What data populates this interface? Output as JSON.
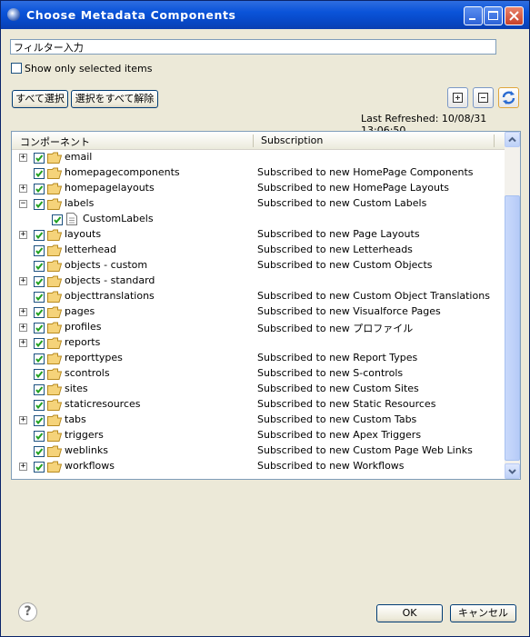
{
  "window": {
    "title": "Choose Metadata Components"
  },
  "filter": {
    "value": "フィルター入力"
  },
  "show_selected": {
    "label": "Show only selected items",
    "checked": false
  },
  "buttons": {
    "select_all": "すべて選択",
    "deselect_all": "選択をすべて解除",
    "ok": "OK",
    "cancel": "キャンセル"
  },
  "toolbar": {
    "expand_all_icon": "expand-all-icon",
    "collapse_all_icon": "collapse-all-icon",
    "refresh_icon": "refresh-icon"
  },
  "last_refreshed": "Last Refreshed: 10/08/31 13:06:50",
  "table": {
    "headers": [
      "コンポーネント",
      "Subscription"
    ],
    "rows": [
      {
        "name": "email",
        "subscription": "",
        "expander": "+",
        "level": 0,
        "type": "folder",
        "checked": true
      },
      {
        "name": "homepagecomponents",
        "subscription": "Subscribed to new HomePage Components",
        "expander": "",
        "level": 0,
        "type": "folder",
        "checked": true
      },
      {
        "name": "homepagelayouts",
        "subscription": "Subscribed to new HomePage Layouts",
        "expander": "+",
        "level": 0,
        "type": "folder",
        "checked": true
      },
      {
        "name": "labels",
        "subscription": "Subscribed to new Custom Labels",
        "expander": "−",
        "level": 0,
        "type": "folder",
        "checked": true
      },
      {
        "name": "CustomLabels",
        "subscription": "",
        "expander": "",
        "level": 1,
        "type": "file",
        "checked": true
      },
      {
        "name": "layouts",
        "subscription": "Subscribed to new Page Layouts",
        "expander": "+",
        "level": 0,
        "type": "folder",
        "checked": true
      },
      {
        "name": "letterhead",
        "subscription": "Subscribed to new Letterheads",
        "expander": "",
        "level": 0,
        "type": "folder",
        "checked": true
      },
      {
        "name": "objects - custom",
        "subscription": "Subscribed to new Custom Objects",
        "expander": "",
        "level": 0,
        "type": "folder",
        "checked": true
      },
      {
        "name": "objects - standard",
        "subscription": "",
        "expander": "+",
        "level": 0,
        "type": "folder",
        "checked": true
      },
      {
        "name": "objecttranslations",
        "subscription": "Subscribed to new Custom Object Translations",
        "expander": "",
        "level": 0,
        "type": "folder",
        "checked": true
      },
      {
        "name": "pages",
        "subscription": "Subscribed to new Visualforce Pages",
        "expander": "+",
        "level": 0,
        "type": "folder",
        "checked": true
      },
      {
        "name": "profiles",
        "subscription": "Subscribed to new プロファイル",
        "expander": "+",
        "level": 0,
        "type": "folder",
        "checked": true
      },
      {
        "name": "reports",
        "subscription": "",
        "expander": "+",
        "level": 0,
        "type": "folder",
        "checked": true
      },
      {
        "name": "reporttypes",
        "subscription": "Subscribed to new Report Types",
        "expander": "",
        "level": 0,
        "type": "folder",
        "checked": true
      },
      {
        "name": "scontrols",
        "subscription": "Subscribed to new S-controls",
        "expander": "",
        "level": 0,
        "type": "folder",
        "checked": true
      },
      {
        "name": "sites",
        "subscription": "Subscribed to new Custom Sites",
        "expander": "",
        "level": 0,
        "type": "folder",
        "checked": true
      },
      {
        "name": "staticresources",
        "subscription": "Subscribed to new Static Resources",
        "expander": "",
        "level": 0,
        "type": "folder",
        "checked": true
      },
      {
        "name": "tabs",
        "subscription": "Subscribed to new Custom Tabs",
        "expander": "+",
        "level": 0,
        "type": "folder",
        "checked": true
      },
      {
        "name": "triggers",
        "subscription": "Subscribed to new Apex Triggers",
        "expander": "",
        "level": 0,
        "type": "folder",
        "checked": true
      },
      {
        "name": "weblinks",
        "subscription": "Subscribed to new Custom Page Web Links",
        "expander": "",
        "level": 0,
        "type": "folder",
        "checked": true
      },
      {
        "name": "workflows",
        "subscription": "Subscribed to new Workflows",
        "expander": "+",
        "level": 0,
        "type": "folder",
        "checked": true
      }
    ]
  },
  "colors": {
    "titlebar": "#0a53d9",
    "check": "#21a121",
    "folder": "#f5d37a",
    "border": "#7f9db9"
  }
}
